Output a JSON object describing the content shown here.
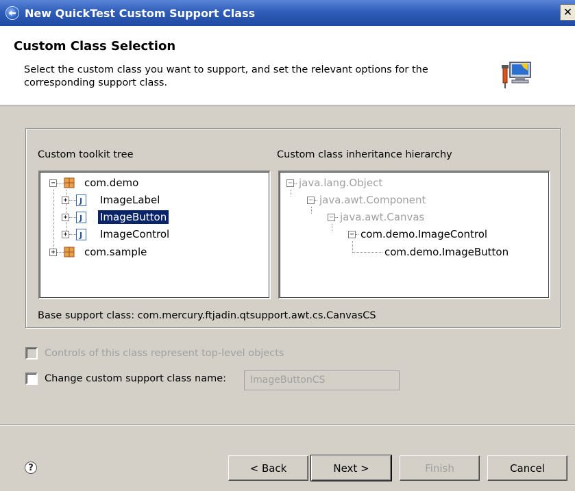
{
  "window": {
    "title": "New QuickTest Custom Support Class",
    "close_label": "✕"
  },
  "header": {
    "title": "Custom Class Selection",
    "description": "Select the custom class you want to support, and set the relevant options for the corresponding support class.",
    "image_icon": "wizard-computer-icon"
  },
  "toolkit_tree": {
    "label": "Custom toolkit tree",
    "nodes": [
      {
        "label": "com.demo",
        "type": "package",
        "expanded": true
      },
      {
        "label": "ImageLabel",
        "type": "class"
      },
      {
        "label": "ImageButton",
        "type": "class",
        "selected": true
      },
      {
        "label": "ImageControl",
        "type": "class"
      },
      {
        "label": "com.sample",
        "type": "package",
        "expanded": false
      }
    ]
  },
  "hierarchy_tree": {
    "label": "Custom class inheritance hierarchy",
    "nodes": [
      {
        "label": "java.lang.Object",
        "disabled": true
      },
      {
        "label": "java.awt.Component",
        "disabled": true
      },
      {
        "label": "java.awt.Canvas",
        "disabled": true
      },
      {
        "label": "com.demo.ImageControl",
        "disabled": false
      },
      {
        "label": "com.demo.ImageButton",
        "disabled": false
      }
    ]
  },
  "base_support_class": "Base support class: com.mercury.ftjadin.qtsupport.awt.cs.CanvasCS",
  "options": {
    "top_level_label": "Controls of this class represent top-level objects",
    "change_name_label": "Change custom support class name:",
    "name_value": "ImageButtonCS"
  },
  "buttons": {
    "help": "?",
    "back": "< Back",
    "next": "Next >",
    "finish": "Finish",
    "cancel": "Cancel"
  },
  "colors": {
    "title_bar": "#2f5db8",
    "selection": "#0a246a",
    "dialog_bg": "#d4d0c8"
  }
}
